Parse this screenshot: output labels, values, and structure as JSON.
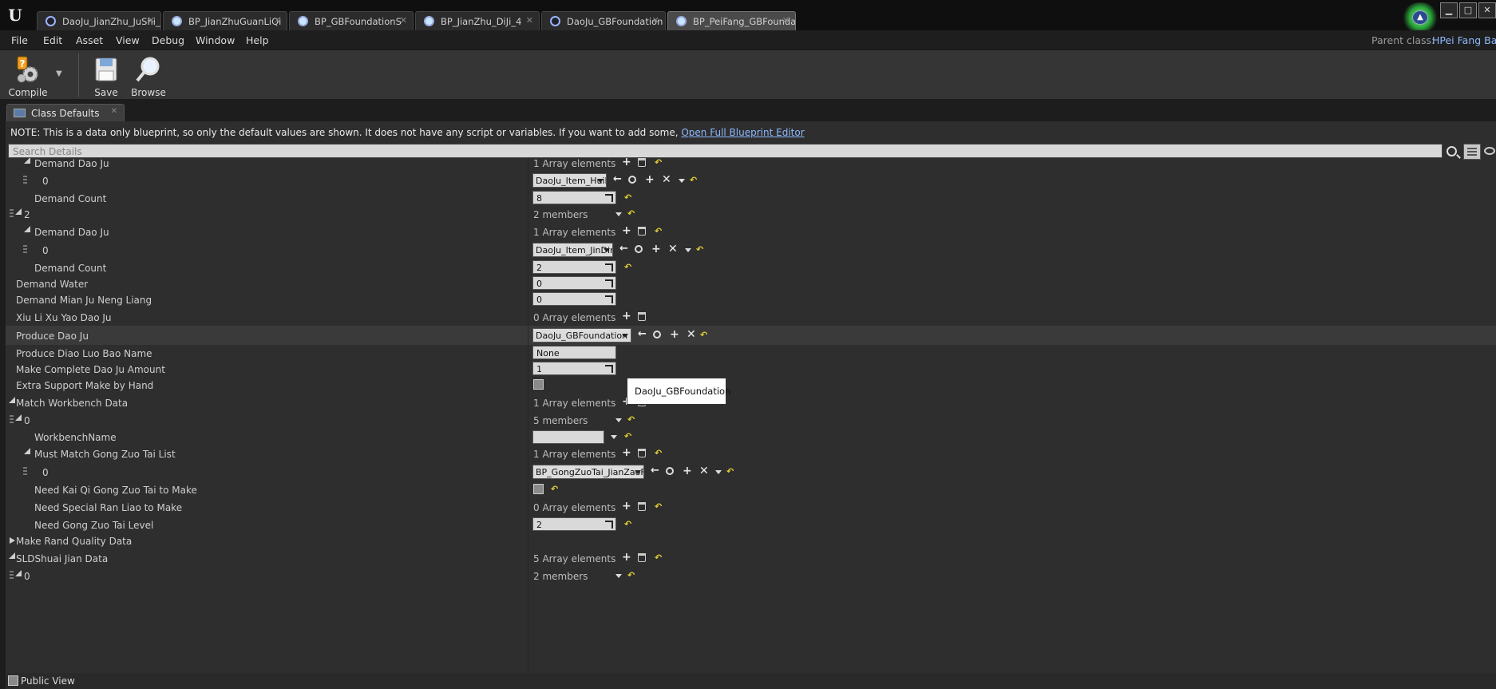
{
  "window": {
    "tabs": [
      {
        "label": "DaoJu_JianZhu_JuShi_Di"
      },
      {
        "label": "BP_JianZhuGuanLiQi"
      },
      {
        "label": "BP_GBFoundationS"
      },
      {
        "label": "BP_JianZhu_DiJi_4"
      },
      {
        "label": "DaoJu_GBFoundation"
      },
      {
        "label": "BP_PeiFang_GBFoundati"
      }
    ],
    "controls": {
      "minimize": "▁",
      "maximize": "□",
      "close": "✕"
    }
  },
  "menubar": {
    "items": [
      "File",
      "Edit",
      "Asset",
      "View",
      "Debug",
      "Window",
      "Help"
    ],
    "parent_class_label": "Parent class:",
    "parent_class_value": "HPei Fang Bas"
  },
  "toolbar": {
    "compile_label": "Compile",
    "save_label": "Save",
    "browse_label": "Browse"
  },
  "panel": {
    "tab_label": "Class Defaults",
    "note_text": "NOTE: This is a data only blueprint, so only the default values are shown.  It does not have any script or variables.  If you want to add some, ",
    "note_link": "Open Full Blueprint Editor",
    "search_placeholder": "Search Details",
    "public_view_label": "Public View"
  },
  "rows": {
    "r0": {
      "label": "Demand Dao Ju",
      "value": "1 Array elements"
    },
    "r1": {
      "label": "0",
      "value": "DaoJu_Item_HuiNi"
    },
    "r2": {
      "label": "Demand Count",
      "value": "8"
    },
    "r3": {
      "label": "2",
      "value": "2 members"
    },
    "r4": {
      "label": "Demand Dao Ju",
      "value": "1 Array elements"
    },
    "r5": {
      "label": "0",
      "value": "DaoJu_Item_JinDing"
    },
    "r6": {
      "label": "Demand Count",
      "value": "2"
    },
    "r7": {
      "label": "Demand Water",
      "value": "0"
    },
    "r8": {
      "label": "Demand Mian Ju Neng Liang",
      "value": "0"
    },
    "r9": {
      "label": "Xiu Li Xu Yao Dao Ju",
      "value": "0 Array elements"
    },
    "r10": {
      "label": "Produce Dao Ju",
      "value": "DaoJu_GBFoundation"
    },
    "r11": {
      "label": "Produce Diao Luo Bao Name",
      "value": "None"
    },
    "r12": {
      "label": "Make Complete Dao Ju Amount",
      "value": "1"
    },
    "r13": {
      "label": "Extra Support Make by Hand",
      "value": ""
    },
    "r14": {
      "label": "Match Workbench Data",
      "value": "1 Array elements"
    },
    "r15": {
      "label": "0",
      "value": "5 members"
    },
    "r16": {
      "label": "WorkbenchName",
      "value": ""
    },
    "r17": {
      "label": "Must Match Gong Zuo Tai List",
      "value": "1 Array elements"
    },
    "r18": {
      "label": "0",
      "value": "BP_GongZuoTai_JianZaoFang"
    },
    "r19": {
      "label": "Need Kai Qi Gong Zuo Tai to Make",
      "value": ""
    },
    "r20": {
      "label": "Need Special Ran Liao to Make",
      "value": "0 Array elements"
    },
    "r21": {
      "label": "Need Gong Zuo Tai Level",
      "value": "2"
    },
    "r22": {
      "label": "Make Rand Quality Data",
      "value": ""
    },
    "r23": {
      "label": "SLDShuai Jian Data",
      "value": "5 Array elements"
    },
    "r24": {
      "label": "0",
      "value": "2 members"
    }
  },
  "tooltip": {
    "text": "DaoJu_GBFoundation"
  },
  "icons": {
    "ue_logo": "unreal-logo-icon",
    "asset_tab": "blueprint-asset-icon",
    "compile": "compile-gear-icon",
    "save": "save-disk-icon",
    "browse": "browse-magnifier-icon",
    "reset": "reset-to-default-icon"
  }
}
